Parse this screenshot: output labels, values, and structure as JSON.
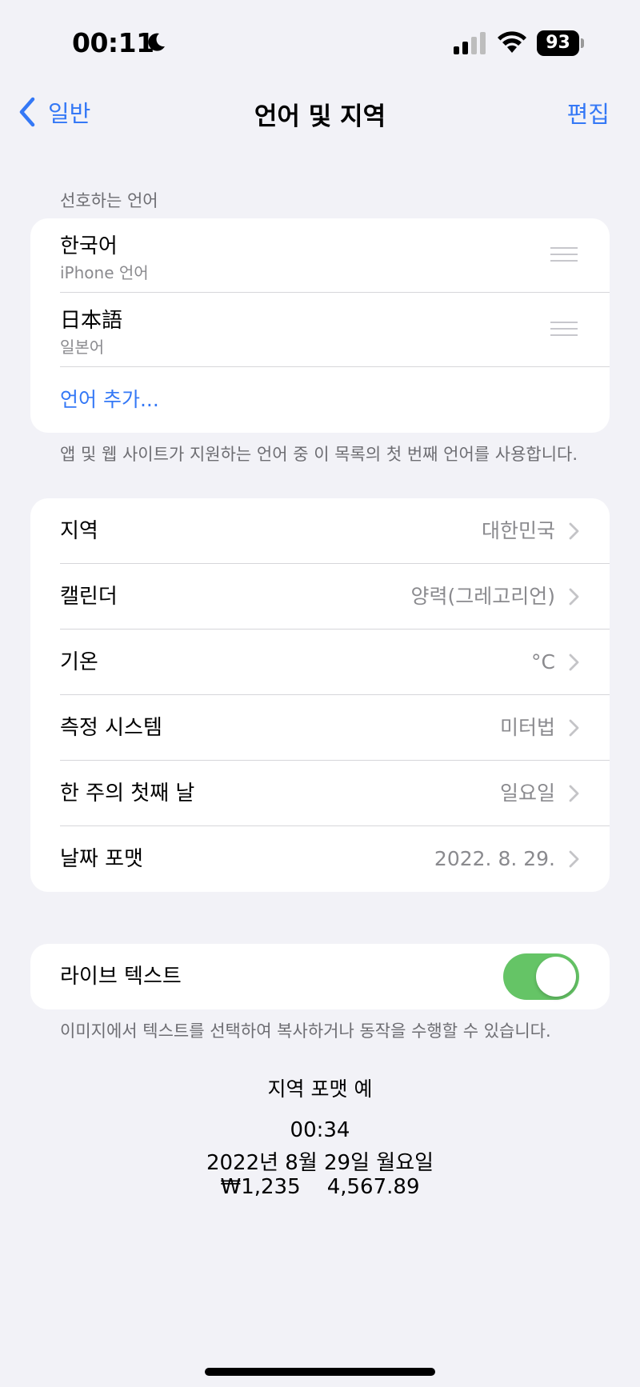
{
  "status_bar": {
    "time": "00:11",
    "battery": "93",
    "moon_icon": "moon-icon",
    "signal_icon": "cellular-signal-icon",
    "wifi_icon": "wifi-icon"
  },
  "nav": {
    "back_label": "일반",
    "title": "언어 및 지역",
    "edit_label": "편집"
  },
  "preferred_languages": {
    "header": "선호하는 언어",
    "items": [
      {
        "name": "한국어",
        "sub": "iPhone 언어"
      },
      {
        "name": "日本語",
        "sub": "일본어"
      }
    ],
    "add_label": "언어 추가...",
    "footer": "앱 및 웹 사이트가 지원하는 언어 중 이 목록의 첫 번째 언어를 사용합니다."
  },
  "region_settings": [
    {
      "label": "지역",
      "value": "대한민국"
    },
    {
      "label": "캘린더",
      "value": "양력(그레고리언)"
    },
    {
      "label": "기온",
      "value": "°C"
    },
    {
      "label": "측정 시스템",
      "value": "미터법"
    },
    {
      "label": "한 주의 첫째 날",
      "value": "일요일"
    },
    {
      "label": "날짜 포맷",
      "value": "2022. 8. 29."
    }
  ],
  "live_text": {
    "label": "라이브 텍스트",
    "enabled": true,
    "footer": "이미지에서 텍스트를 선택하여 복사하거나 동작을 수행할 수 있습니다."
  },
  "region_format_example": {
    "title": "지역 포맷 예",
    "time": "00:34",
    "date": "2022년 8월 29일 월요일",
    "numbers": "₩1,235    4,567.89"
  },
  "colors": {
    "accent": "#3478f6",
    "toggle_on": "#65c466",
    "background": "#f2f2f7"
  }
}
